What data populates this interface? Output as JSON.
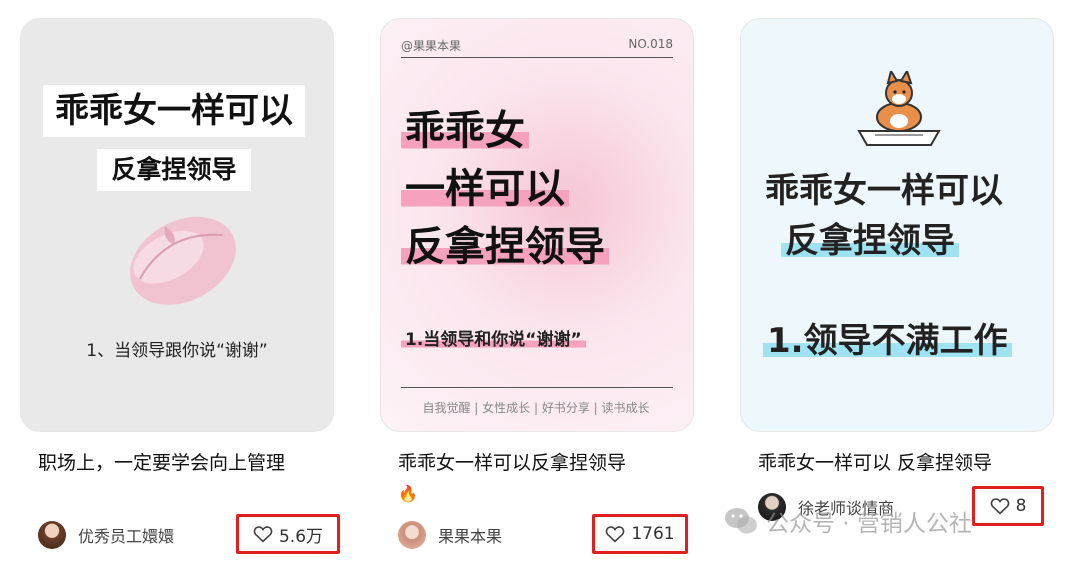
{
  "cards": [
    {
      "cover": {
        "line1": "乖乖女一样可以",
        "line2": "反拿捏领导",
        "sub": "1、当领导跟你说“谢谢”"
      },
      "title": "职场上，一定要学会向上管理",
      "author": "优秀员工嬛嬛",
      "likes": "5.6万"
    },
    {
      "cover": {
        "handle": "@果果本果",
        "issue": "NO.018",
        "line1": "乖乖女",
        "line2": "一样可以",
        "line3": "反拿捏领导",
        "sub": "1.当领导和你说“谢谢”",
        "footer": "自我觉醒 | 女性成长 | 好书分享 | 读书成长"
      },
      "title": "乖乖女一样可以反拿捏领导",
      "title_emoji": "🔥",
      "author": "果果本果",
      "likes": "1761"
    },
    {
      "cover": {
        "line1": "乖乖女一样可以",
        "line2": "反拿捏领导",
        "line3": "1.领导不满工作"
      },
      "title": "乖乖女一样可以 反拿捏领导",
      "author": "徐老师谈情商",
      "likes": "8"
    }
  ],
  "watermark": "公众号 · 营销人公社",
  "colors": {
    "highlight_box": "#e02020",
    "pink_marker": "#f6a1bd",
    "blue_marker": "#9fe3f2"
  }
}
